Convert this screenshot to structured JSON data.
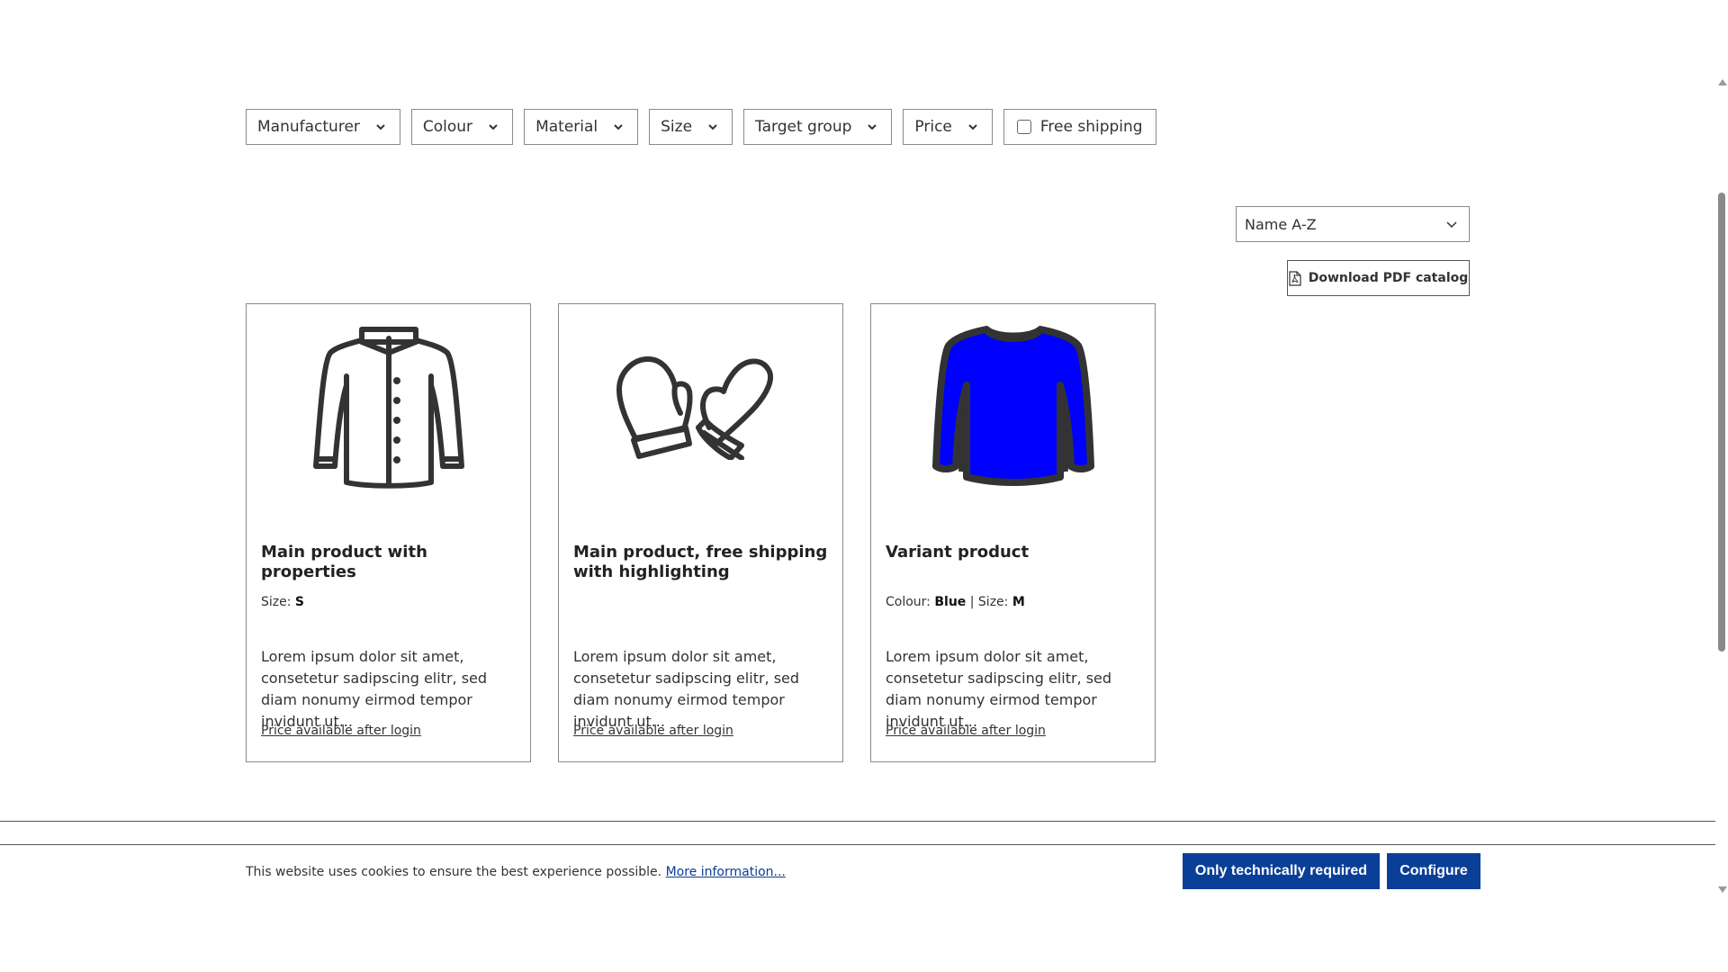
{
  "filters": {
    "manufacturer": "Manufacturer",
    "colour": "Colour",
    "material": "Material",
    "size": "Size",
    "target_group": "Target group",
    "price": "Price",
    "free_shipping": "Free shipping"
  },
  "sorting": {
    "selected": "Name A-Z"
  },
  "pdf_catalog": "Download PDF catalog",
  "products": [
    {
      "title": "Main product with properties",
      "props": [
        {
          "label": "Size:",
          "value": "S"
        }
      ],
      "description": "Lorem ipsum dolor sit amet, consetetur sadipscing elitr, sed diam nonumy eirmod tempor invidunt ut...",
      "price": "Price available after login",
      "icon": "jacket-icon"
    },
    {
      "title": "Main product, free shipping with highlighting",
      "props": [],
      "description": "Lorem ipsum dolor sit amet, consetetur sadipscing elitr, sed diam nonumy eirmod tempor invidunt ut...",
      "price": "Price available after login",
      "icon": "mittens-icon"
    },
    {
      "title": "Variant product",
      "props": [
        {
          "label": "Colour:",
          "value": "Blue"
        },
        {
          "label": "Size:",
          "value": "M"
        }
      ],
      "description": "Lorem ipsum dolor sit amet, consetetur sadipscing elitr, sed diam nonumy eirmod tempor invidunt ut...",
      "price": "Price available after login",
      "icon": "sweater-icon",
      "color": "#0000ff"
    }
  ],
  "cookie": {
    "text": "This website uses cookies to ensure the best experience possible.",
    "link": "More information...",
    "btn_required": "Only technically required",
    "btn_configure": "Configure"
  }
}
